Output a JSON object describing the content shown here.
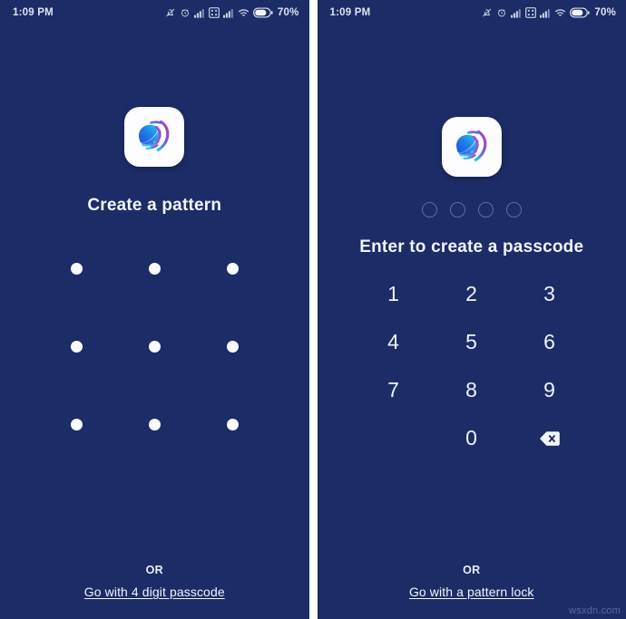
{
  "meta": {
    "background_color": "#1b2c66",
    "accent_text_color": "#f2f5fb",
    "watermark": "wsxdn.com"
  },
  "status_bar": {
    "time": "1:09 PM",
    "battery_percent": "70%",
    "icons": [
      "mute-icon",
      "alarm-icon",
      "signal-bars-icon",
      "sim-card-icon",
      "signal-bars-icon",
      "wifi-icon",
      "battery-icon"
    ]
  },
  "pattern_screen": {
    "logo_name": "app-logo-icon",
    "title": "Create a pattern",
    "dots": [
      1,
      2,
      3,
      4,
      5,
      6,
      7,
      8,
      9
    ],
    "or_label": "OR",
    "switch_link": "Go with 4 digit passcode"
  },
  "passcode_screen": {
    "logo_name": "app-logo-icon",
    "title": "Enter to create a passcode",
    "passcode_length": 4,
    "entered_digits": 0,
    "keys": [
      {
        "label": "1",
        "name": "key-1"
      },
      {
        "label": "2",
        "name": "key-2"
      },
      {
        "label": "3",
        "name": "key-3"
      },
      {
        "label": "4",
        "name": "key-4"
      },
      {
        "label": "5",
        "name": "key-5"
      },
      {
        "label": "6",
        "name": "key-6"
      },
      {
        "label": "7",
        "name": "key-7"
      },
      {
        "label": "8",
        "name": "key-8"
      },
      {
        "label": "9",
        "name": "key-9"
      },
      {
        "label": "",
        "name": "key-blank"
      },
      {
        "label": "0",
        "name": "key-0"
      },
      {
        "label": "",
        "name": "key-backspace"
      }
    ],
    "backspace_icon": "backspace-icon",
    "or_label": "OR",
    "switch_link": "Go with a pattern lock"
  }
}
